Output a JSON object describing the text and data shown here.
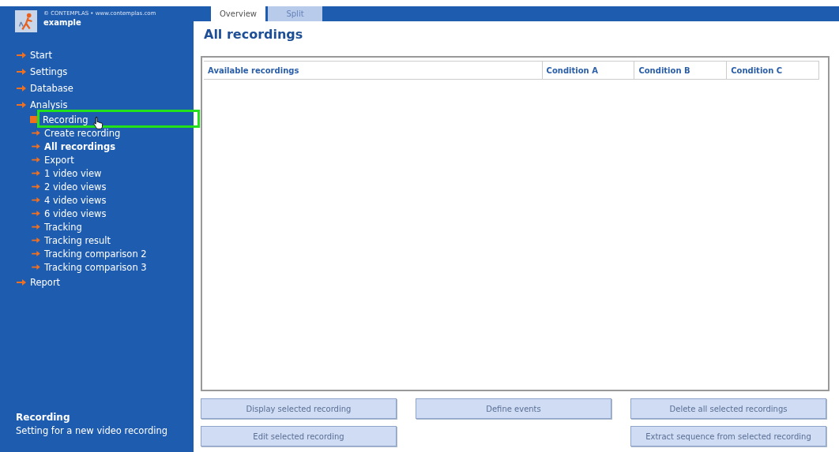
{
  "brand": {
    "copyright": "© CONTEMPLAS • www.contemplas.com",
    "project": "example"
  },
  "tabs": [
    {
      "label": "Overview",
      "selected": true
    },
    {
      "label": "Split",
      "selected": false
    }
  ],
  "title": "All recordings",
  "nav": [
    {
      "label": "Start",
      "selected": false
    },
    {
      "label": "Settings",
      "selected": false
    },
    {
      "label": "Database",
      "selected": false
    },
    {
      "label": "Analysis",
      "selected": false,
      "children": [
        {
          "label": "Recording",
          "kind": "square",
          "selected": false,
          "highlighted": true,
          "hovered": true
        },
        {
          "label": "Create recording",
          "kind": "arrow",
          "selected": false
        },
        {
          "label": "All recordings",
          "kind": "arrow",
          "selected": true
        },
        {
          "label": "Export",
          "kind": "arrow",
          "selected": false
        },
        {
          "label": "1 video view",
          "kind": "arrow",
          "selected": false
        },
        {
          "label": "2 video views",
          "kind": "arrow",
          "selected": false
        },
        {
          "label": "4 video views",
          "kind": "arrow",
          "selected": false
        },
        {
          "label": "6 video views",
          "kind": "arrow",
          "selected": false
        },
        {
          "label": "Tracking",
          "kind": "arrow",
          "selected": false
        },
        {
          "label": "Tracking result",
          "kind": "arrow",
          "selected": false
        },
        {
          "label": "Tracking comparison 2",
          "kind": "arrow",
          "selected": false
        },
        {
          "label": "Tracking comparison 3",
          "kind": "arrow",
          "selected": false
        }
      ]
    },
    {
      "label": "Report",
      "selected": false
    }
  ],
  "info": {
    "title": "Recording",
    "text": "Setting for a new video recording"
  },
  "table": {
    "columns": [
      "Available recordings",
      "Condition A",
      "Condition B",
      "Condition C"
    ]
  },
  "buttons": [
    [
      "Display selected recording",
      "Edit selected recording"
    ],
    [
      "Define events"
    ],
    [
      "Delete all selected recordings",
      "Extract sequence from selected recording"
    ]
  ]
}
